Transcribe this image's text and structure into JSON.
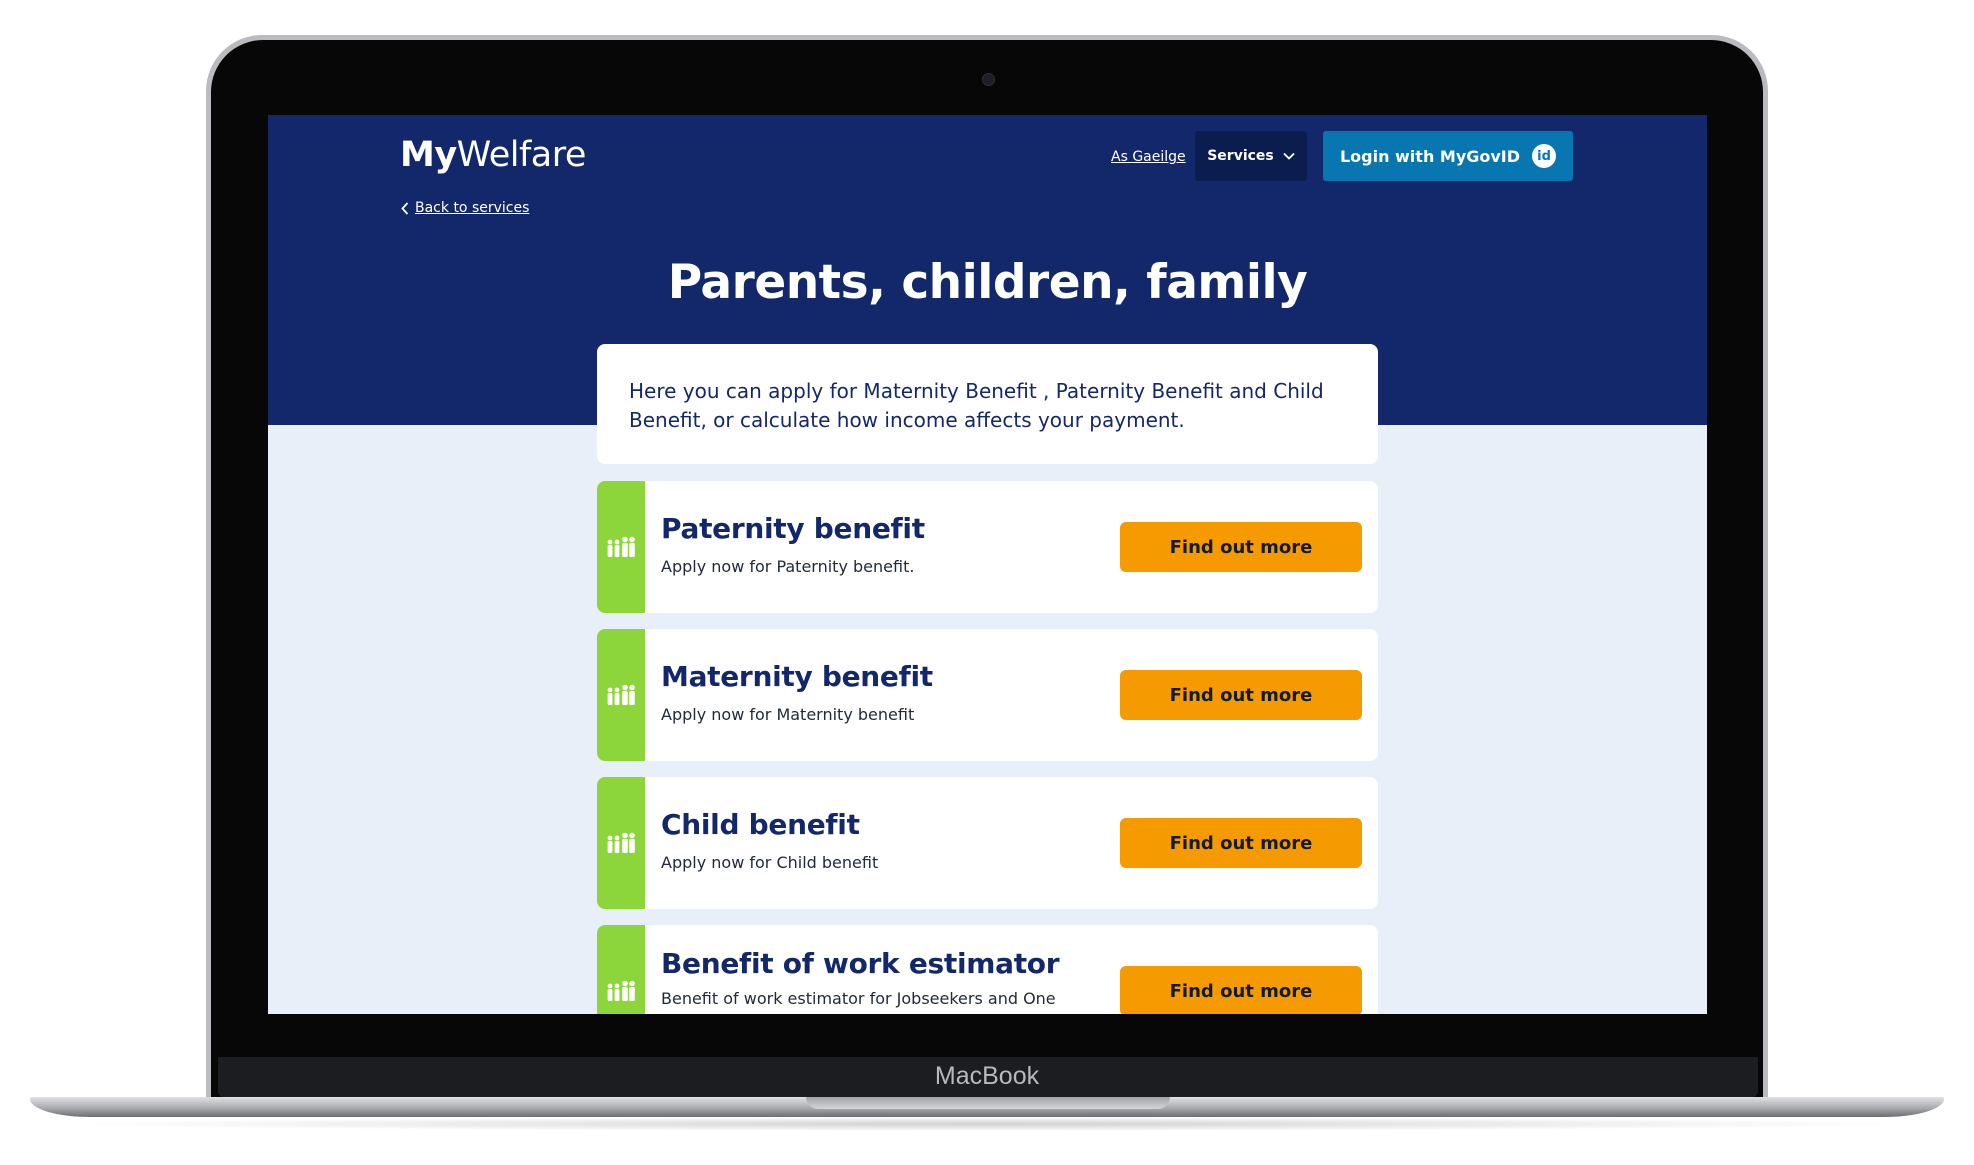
{
  "device": {
    "brand_label": "MacBook"
  },
  "header": {
    "logo_my": "My",
    "logo_welfare": "Welfare",
    "language_link": "As Gaeilge",
    "services_label": "Services",
    "login_label": "Login with MyGovID",
    "login_badge": "id",
    "back_label": "Back to services"
  },
  "page": {
    "title": "Parents, children, family",
    "intro": "Here you can apply for Maternity Benefit , Paternity Benefit and Child Benefit, or calculate how income affects your payment."
  },
  "cards": [
    {
      "title": "Paternity benefit",
      "description": "Apply now for Paternity benefit.",
      "button": "Find out more"
    },
    {
      "title": "Maternity benefit",
      "description": "Apply now for Maternity benefit",
      "button": "Find out more"
    },
    {
      "title": "Child benefit",
      "description": "Apply now for Child benefit",
      "button": "Find out more"
    },
    {
      "title": "Benefit of work estimator",
      "description": "Benefit of work estimator for Jobseekers and One Parent Family payment",
      "button": "Find out more"
    }
  ],
  "colors": {
    "header_bg": "#13286a",
    "page_bg": "#e9eff9",
    "login_bg": "#0877b1",
    "services_bg": "#0b1c4f",
    "accent_strip": "#8cd63b",
    "cta_button": "#f59a00"
  },
  "icons": {
    "card_icon": "family-icon",
    "services_caret": "chevron-down-icon",
    "back_caret": "chevron-left-icon"
  }
}
